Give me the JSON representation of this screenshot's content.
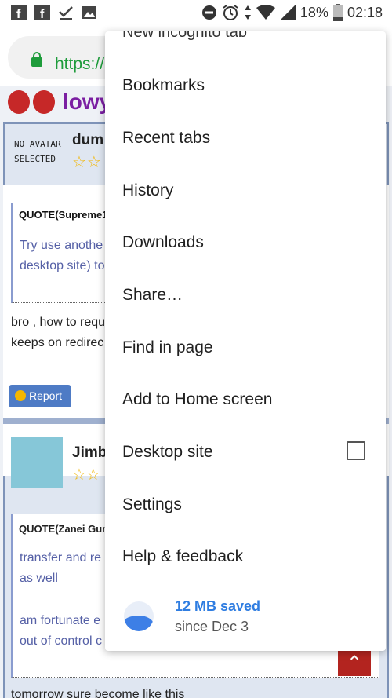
{
  "status_bar": {
    "battery": "18%",
    "time": "02:18",
    "icons": [
      "facebook-icon",
      "facebook-icon",
      "check-download-icon",
      "image-icon",
      "dnd-icon",
      "alarm-icon",
      "data-arrows-icon",
      "wifi-icon",
      "signal-icon",
      "battery-icon"
    ]
  },
  "address_bar": {
    "url": "https://"
  },
  "page": {
    "logo_text": "lowy",
    "post1": {
      "avatar_text_line1": "NO AVATAR",
      "avatar_text_line2": "SELECTED",
      "username": "dum",
      "stars": "☆☆",
      "quote_header": "QUOTE(Supreme1",
      "quote_line1": "Try use anothe",
      "quote_line2": "desktop site) to",
      "text_line1": "bro , how to requ",
      "text_line2": "keeps on redirec",
      "report_label": "Report"
    },
    "post2": {
      "username": "Jimb",
      "stars": "☆☆",
      "quote_header": "QUOTE(Zanei Gun",
      "quote_a_line1": "transfer and re",
      "quote_a_line2": "as well",
      "quote_b_line1": "am fortunate e",
      "quote_b_line2": "out of control c",
      "bottom_text": "tomorrow sure become like this"
    }
  },
  "menu": {
    "partial_top": "New incognito tab",
    "items": [
      {
        "label": "Bookmarks"
      },
      {
        "label": "Recent tabs"
      },
      {
        "label": "History"
      },
      {
        "label": "Downloads"
      },
      {
        "label": "Share…"
      },
      {
        "label": "Find in page"
      },
      {
        "label": "Add to Home screen"
      },
      {
        "label": "Desktop site"
      },
      {
        "label": "Settings"
      },
      {
        "label": "Help & feedback"
      }
    ],
    "data_saver": {
      "title": "12 MB saved",
      "subtitle": "since Dec 3"
    },
    "desktop_site_checked": false
  },
  "colors": {
    "secure_green": "#1e9c3b",
    "saver_blue": "#2f7de1",
    "report_blue": "#4e7bc5",
    "scroll_top_red": "#b3241f"
  }
}
